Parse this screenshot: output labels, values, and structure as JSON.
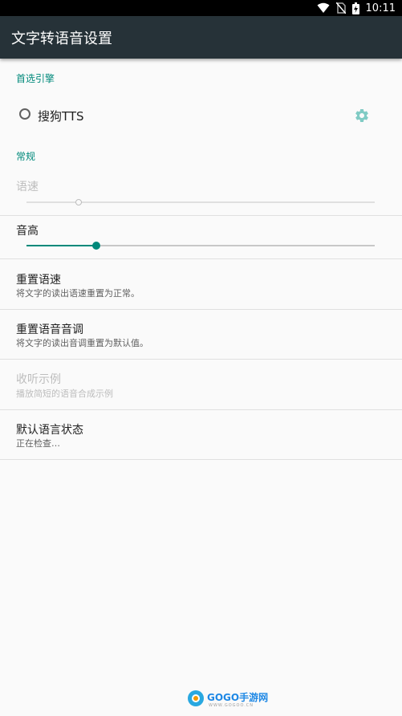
{
  "status_bar": {
    "time": "10:11"
  },
  "app_bar": {
    "title": "文字转语音设置"
  },
  "sections": {
    "preferred_engine_header": "首选引擎",
    "general_header": "常规"
  },
  "engine": {
    "label": "搜狗TTS",
    "selected": false
  },
  "speech_rate": {
    "title": "语速",
    "enabled": false,
    "level": 0.15
  },
  "pitch": {
    "title": "音高",
    "enabled": true,
    "level": 0.2
  },
  "reset_rate": {
    "title": "重置语速",
    "summary": "将文字的读出语速重置为正常。"
  },
  "reset_pitch": {
    "title": "重置语音音调",
    "summary": "将文字的读出音调重置为默认值。"
  },
  "listen_example": {
    "title": "收听示例",
    "summary": "播放简短的语音合成示例",
    "enabled": false
  },
  "default_language_status": {
    "title": "默认语言状态",
    "summary": "正在检查…"
  },
  "watermark": {
    "text": "GOGO手游网",
    "sub": "WWW.GOGOO.CN"
  },
  "colors": {
    "accent": "#00897b",
    "app_bar": "#263238",
    "status_bar": "#000000",
    "background": "#fafafa"
  }
}
